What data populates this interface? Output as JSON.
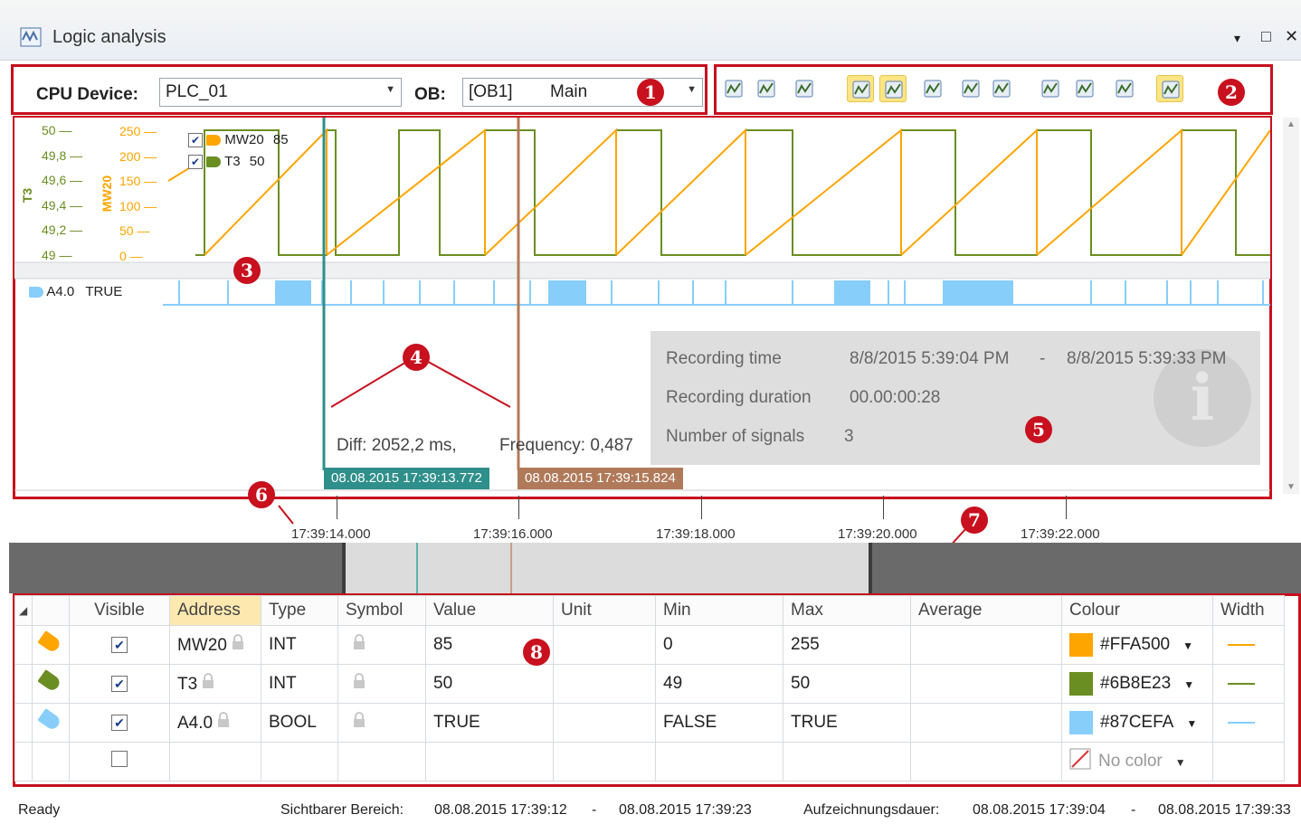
{
  "window": {
    "title": "Logic analysis",
    "controls": [
      "▾",
      "□",
      "✕"
    ]
  },
  "toolbar_left": {
    "cpu_label": "CPU Device:",
    "cpu_value": "PLC_01",
    "ob_label": "OB:",
    "ob_value_code": "[OB1]",
    "ob_value_name": "Main"
  },
  "toolbar_right": {
    "buttons": [
      {
        "icon": "record-start-icon",
        "active": false
      },
      {
        "icon": "record-stop-icon",
        "active": false
      },
      {
        "icon": "record-settings-icon",
        "active": false
      },
      {
        "icon": "cursor-left-icon",
        "active": true
      },
      {
        "icon": "cursor-right-icon",
        "active": true
      },
      {
        "icon": "signal-edit-icon",
        "active": false
      },
      {
        "icon": "link-icon",
        "active": false
      },
      {
        "icon": "unlink-icon",
        "active": false
      },
      {
        "icon": "import-icon",
        "active": false
      },
      {
        "icon": "save-icon",
        "active": false
      },
      {
        "icon": "export-icon",
        "active": false
      },
      {
        "icon": "info-icon",
        "active": true
      }
    ]
  },
  "markers": [
    "1",
    "2",
    "3",
    "4",
    "5",
    "6",
    "7",
    "8"
  ],
  "chart": {
    "left_axis_t3": [
      "50",
      "49,8",
      "49,6",
      "49,4",
      "49,2",
      "49"
    ],
    "left_axis_mw20": [
      "250",
      "200",
      "150",
      "100",
      "50",
      "0"
    ],
    "axis_title_t3": "T3",
    "axis_title_mw20": "MW20",
    "legend": [
      {
        "name": "MW20",
        "value": "85",
        "color": "#FFA500"
      },
      {
        "name": "T3",
        "value": "50",
        "color": "#6B8E23"
      }
    ],
    "bool_signal": {
      "name": "A4.0",
      "value": "TRUE",
      "color": "#87CEFA"
    }
  },
  "cursors": {
    "diff_text": "Diff: 2052,2 ms,",
    "frequency_text": "Frequency: 0,487",
    "cursor1_label": "08.08.2015 17:39:13.772",
    "cursor2_label": "08.08.2015 17:39:15.824",
    "cursor1_color": "#2f8f8a",
    "cursor2_color": "#b07a5a"
  },
  "info_panel": {
    "recording_time_label": "Recording time",
    "recording_time_from": "8/8/2015 5:39:04 PM",
    "recording_time_sep": "-",
    "recording_time_to": "8/8/2015 5:39:33 PM",
    "duration_label": "Recording duration",
    "duration_value": "00.00:00:28",
    "signals_label": "Number of signals",
    "signals_value": "3"
  },
  "timeline": {
    "ticks": [
      "17:39:14.000",
      "17:39:16.000",
      "17:39:18.000",
      "17:39:20.000",
      "17:39:22.000"
    ]
  },
  "table": {
    "columns": [
      "Visible",
      "Address",
      "Type",
      "Symbol",
      "Value",
      "Unit",
      "Min",
      "Max",
      "Average",
      "Colour",
      "Width"
    ],
    "rows": [
      {
        "tag_color": "#FFA500",
        "visible": true,
        "address": "MW20",
        "type": "INT",
        "value": "85",
        "unit": "",
        "min": "0",
        "max": "255",
        "average": "",
        "colour": "#FFA500",
        "width_color": "#FFA500"
      },
      {
        "tag_color": "#6B8E23",
        "visible": true,
        "address": "T3",
        "type": "INT",
        "value": "50",
        "unit": "",
        "min": "49",
        "max": "50",
        "average": "",
        "colour": "#6B8E23",
        "width_color": "#6B8E23"
      },
      {
        "tag_color": "#87CEFA",
        "visible": true,
        "address": "A4.0",
        "type": "BOOL",
        "value": "TRUE",
        "unit": "",
        "min": "FALSE",
        "max": "TRUE",
        "average": "",
        "colour": "#87CEFA",
        "width_color": "#87CEFA"
      }
    ],
    "empty_row_colour": "No color"
  },
  "status": {
    "state": "Ready",
    "visible_label": "Sichtbarer Bereich:",
    "visible_from": "08.08.2015 17:39:12",
    "visible_sep": "-",
    "visible_to": "08.08.2015 17:39:23",
    "duration_label": "Aufzeichnungsdauer:",
    "duration_from": "08.08.2015 17:39:04",
    "duration_sep": "-",
    "duration_to": "08.08.2015 17:39:33"
  }
}
